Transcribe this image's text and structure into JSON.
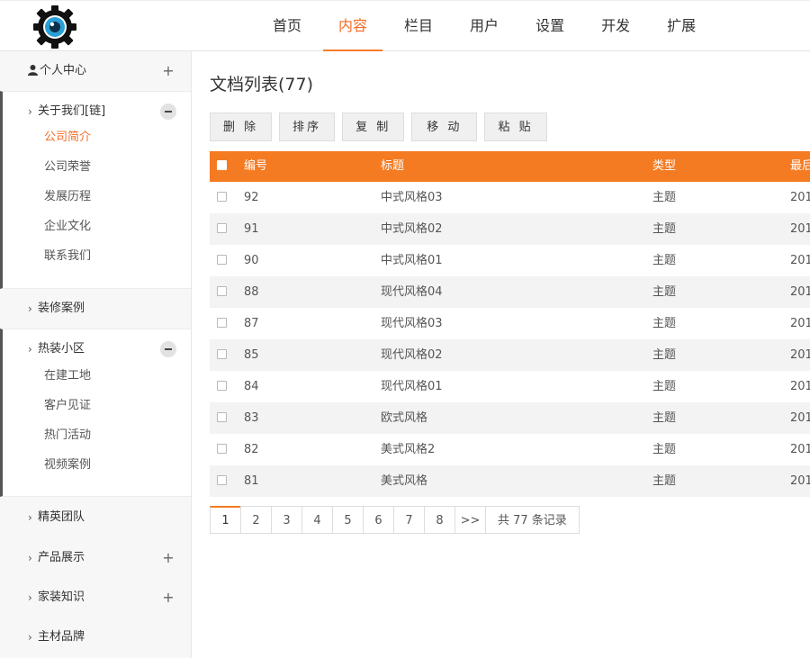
{
  "nav": {
    "items": [
      {
        "label": "首页",
        "active": false
      },
      {
        "label": "内容",
        "active": true
      },
      {
        "label": "栏目",
        "active": false
      },
      {
        "label": "用户",
        "active": false
      },
      {
        "label": "设置",
        "active": false
      },
      {
        "label": "开发",
        "active": false
      },
      {
        "label": "扩展",
        "active": false
      }
    ],
    "accent": "#f26d27"
  },
  "sidebar": {
    "personal": "个人中心",
    "about": {
      "label": "关于我们[链]",
      "children": [
        "公司简介",
        "公司荣誉",
        "发展历程",
        "企业文化",
        "联系我们"
      ]
    },
    "cases": "装修案例",
    "hot": {
      "label": "热装小区",
      "children": [
        "在建工地",
        "客户见证",
        "热门活动",
        "视频案例"
      ]
    },
    "team": "精英团队",
    "products": "产品展示",
    "knowledge": "家装知识",
    "brands": "主材品牌"
  },
  "main": {
    "title": "文档列表(77)",
    "toolbar": {
      "delete": "删 除",
      "sort": "排序",
      "copy": "复 制",
      "move": "移 动",
      "paste": "粘 贴"
    },
    "table": {
      "headers": {
        "id": "编号",
        "title": "标题",
        "type": "类型",
        "date": "最后"
      },
      "rows": [
        {
          "id": "92",
          "title": "中式风格03",
          "type": "主题",
          "date": "201"
        },
        {
          "id": "91",
          "title": "中式风格02",
          "type": "主题",
          "date": "201"
        },
        {
          "id": "90",
          "title": "中式风格01",
          "type": "主题",
          "date": "201"
        },
        {
          "id": "88",
          "title": "现代风格04",
          "type": "主题",
          "date": "201"
        },
        {
          "id": "87",
          "title": "现代风格03",
          "type": "主题",
          "date": "201"
        },
        {
          "id": "85",
          "title": "现代风格02",
          "type": "主题",
          "date": "201"
        },
        {
          "id": "84",
          "title": "现代风格01",
          "type": "主题",
          "date": "201"
        },
        {
          "id": "83",
          "title": "欧式风格",
          "type": "主题",
          "date": "201"
        },
        {
          "id": "82",
          "title": "美式风格2",
          "type": "主题",
          "date": "201"
        },
        {
          "id": "81",
          "title": "美式风格",
          "type": "主题",
          "date": "201"
        }
      ],
      "header_color": "#f57b23"
    },
    "pagination": {
      "pages": [
        "1",
        "2",
        "3",
        "4",
        "5",
        "6",
        "7",
        "8"
      ],
      "current": "1",
      "next": ">>",
      "summary": "共 77 条记录"
    }
  }
}
